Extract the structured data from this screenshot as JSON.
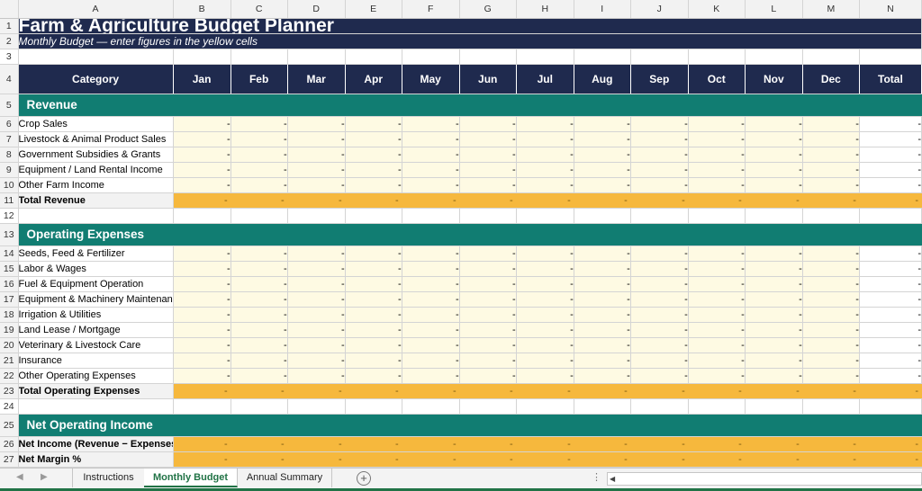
{
  "columns": [
    "A",
    "B",
    "C",
    "D",
    "E",
    "F",
    "G",
    "H",
    "I",
    "J",
    "K",
    "L",
    "M",
    "N"
  ],
  "title": "Farm & Agriculture Budget Planner",
  "subtitle": "Monthly Budget — enter figures in the yellow cells",
  "header": {
    "category": "Category",
    "months": [
      "Jan",
      "Feb",
      "Mar",
      "Apr",
      "May",
      "Jun",
      "Jul",
      "Aug",
      "Sep",
      "Oct",
      "Nov",
      "Dec"
    ],
    "total": "Total"
  },
  "empty_value": "-",
  "sections": {
    "revenue": {
      "title": "Revenue",
      "rows": [
        "Crop Sales",
        "Livestock & Animal Product Sales",
        "Government Subsidies & Grants",
        "Equipment / Land Rental Income",
        "Other Farm Income"
      ],
      "total_label": "Total Revenue"
    },
    "expenses": {
      "title": "Operating Expenses",
      "rows": [
        "Seeds, Feed & Fertilizer",
        "Labor & Wages",
        "Fuel & Equipment Operation",
        "Equipment & Machinery Maintenance",
        "Irrigation & Utilities",
        "Land Lease / Mortgage",
        "Veterinary & Livestock Care",
        "Insurance",
        "Other Operating Expenses"
      ],
      "total_label": "Total Operating Expenses"
    },
    "net": {
      "title": "Net Operating Income",
      "row_label": "Net Income (Revenue − Expenses)",
      "partial_label": "Net Margin %"
    }
  },
  "sheet_tabs": [
    {
      "label": "Instructions",
      "active": false
    },
    {
      "label": "Monthly Budget",
      "active": true
    },
    {
      "label": "Annual Summary",
      "active": false
    }
  ],
  "colors": {
    "navy": "#1f2a4e",
    "teal": "#117d72",
    "input_yellow": "#fefae3",
    "total_orange": "#f6b83d",
    "excel_green": "#217346"
  }
}
